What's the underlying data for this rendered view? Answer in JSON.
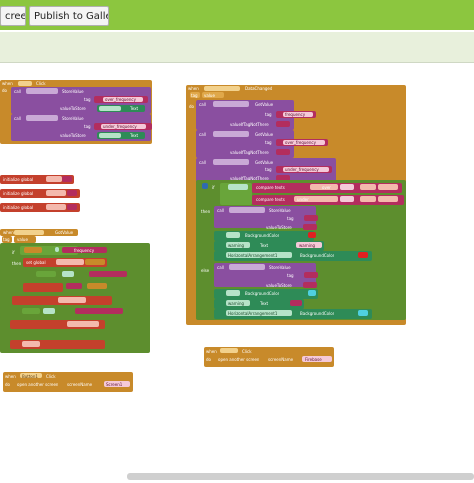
{
  "toolbar": {
    "screen_label": "creen",
    "publish_label": "Publish to Gallery"
  },
  "blocks": {
    "when_click_1": "when",
    "click_1": "Click",
    "call_1": "call",
    "store_value_1": "StoreValue",
    "tag_1": "tag",
    "over_frequency": "over_frequency",
    "value_to_store_1": "valueToStore",
    "text_1": "Text",
    "call_2": "call",
    "store_value_2": "StoreValue",
    "tag_2": "tag",
    "under_frequency": "under_frequency",
    "value_to_store_2": "valueToStore",
    "text_2": "Text",
    "init_global_1": "initialize global",
    "init_global_2": "initialize global",
    "init_global_3": "initialize global",
    "when_got_value": "when",
    "got_value": "GotValue",
    "tag_value": "tag",
    "value_label": "value",
    "if_label": "if",
    "then_label": "then",
    "set_global_1": "set global",
    "get_tag_1": "get tag",
    "get_value_1": "get value",
    "frequency_1": "frequency",
    "when_data_changed": "when",
    "data_changed": "DataChanged",
    "tag_dc": "tag",
    "value_dc": "value",
    "do_dc": "do",
    "call_get_1": "call",
    "get_value_fn_1": "GetValue",
    "tag_get_1": "tag",
    "frequency_2": "frequency",
    "value_if_tag_1": "valueIfTagNotThere",
    "call_get_2": "call",
    "get_value_fn_2": "GetValue",
    "tag_get_2": "tag",
    "over_frequency_2": "over_frequency",
    "value_if_tag_2": "valueIfTagNotThere",
    "call_get_3": "call",
    "get_value_fn_3": "GetValue",
    "tag_get_3": "tag",
    "under_frequency_2": "under_frequency",
    "value_if_tag_3": "valueIfTagNotThere",
    "compare_1": "compare texts",
    "over_text": "over",
    "compare_2": "compare texts",
    "under_text": "under",
    "then_dc": "then",
    "call_store_3": "call",
    "store_value_3": "StoreValue",
    "tag_3": "tag",
    "value_to_store_3": "valueToStore",
    "background_color_1": "BackgroundColor",
    "warning_1": "warning",
    "text_warning": "Text",
    "warning_word": "warning",
    "horizontal_1": "HorizontalArrangement1",
    "background_color_2": "BackgroundColor",
    "else_label": "else",
    "call_store_4": "call",
    "store_value_4": "StoreValue",
    "tag_4": "tag",
    "value_to_store_4": "valueToStore",
    "background_color_3": "BackgroundColor",
    "warning_2": "warning",
    "text_warning_2": "Text",
    "horizontal_2": "HorizontalArrangement1",
    "background_color_4": "BackgroundColor",
    "when_data_click": "when",
    "data_click": "Click",
    "do_open": "do",
    "open_another_1": "open another screen",
    "screen_name_1": "screenName",
    "firebase_screen": "Firebase",
    "when_button_click": "when",
    "button1": "Button1",
    "click_2": "Click",
    "do_2": "do",
    "open_another_2": "open another screen",
    "screen_name_2": "screenName",
    "screen1": "Screen1"
  }
}
